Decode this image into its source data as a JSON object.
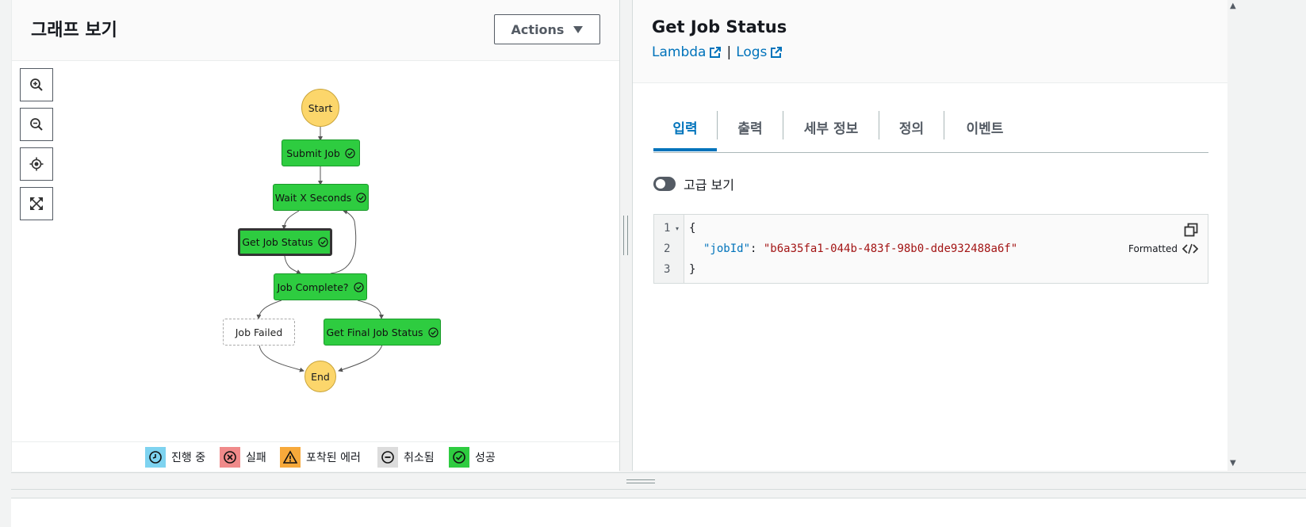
{
  "graph_panel": {
    "title": "그래프 보기",
    "actions_label": "Actions",
    "tools": [
      "zoom-in",
      "zoom-out",
      "center",
      "fit-to-screen"
    ],
    "nodes": {
      "start": "Start",
      "submit_job": "Submit Job",
      "wait": "Wait X Seconds",
      "get_job_status": "Get Job Status",
      "job_complete": "Job Complete?",
      "job_failed": "Job Failed",
      "get_final": "Get Final Job Status",
      "end": "End"
    },
    "legend": [
      {
        "label": "진행 중",
        "color": "#7ed3f0",
        "icon": "clock-icon"
      },
      {
        "label": "실패",
        "color": "#f08a8a",
        "icon": "x-circle-icon"
      },
      {
        "label": "포착된 에러",
        "color": "#f7a93b",
        "icon": "warning-icon"
      },
      {
        "label": "취소됨",
        "color": "#dcdcdc",
        "icon": "minus-circle-icon"
      },
      {
        "label": "성공",
        "color": "#2ecc40",
        "icon": "check-circle-icon"
      }
    ],
    "colors": {
      "success": "#2ecc40",
      "pending": "#fcd66b"
    }
  },
  "detail_panel": {
    "title": "Get Job Status",
    "links": [
      "Lambda",
      "Logs"
    ],
    "link_separator": "|",
    "tabs": [
      "입력",
      "출력",
      "세부 정보",
      "정의",
      "이벤트"
    ],
    "active_tab": "입력",
    "toggle_label": "고급 보기",
    "code": {
      "line_numbers": [
        "1",
        "2",
        "3"
      ],
      "open_brace": "{",
      "key": "\"jobId\"",
      "colon": ": ",
      "value": "\"b6a35fa1-044b-483f-98b0-dde932488a6f\"",
      "close_brace": "}",
      "formatted_label": "Formatted"
    },
    "accent_color": "#0073bb"
  }
}
